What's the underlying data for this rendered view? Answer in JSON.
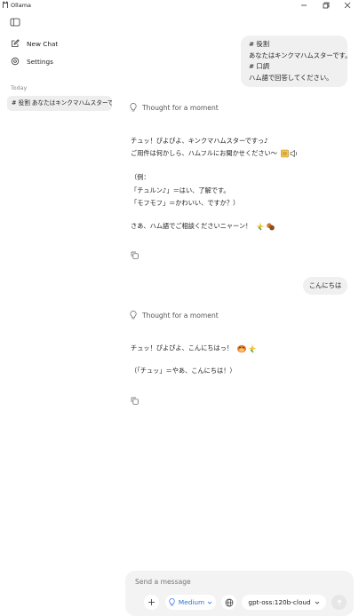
{
  "window": {
    "title": "Ollama",
    "icon": "llama-icon",
    "controls": [
      "minimize-icon",
      "restore-icon",
      "close-icon"
    ]
  },
  "sidebar": {
    "toggle_icon": "sidebar-toggle-icon",
    "new_chat_label": "New Chat",
    "settings_label": "Settings",
    "section_label": "Today",
    "chats": [
      {
        "label": "# 役割 あなたはキンクマハムスターで..."
      }
    ]
  },
  "conversation": {
    "first_user_message": [
      "# 役割",
      "あなたはキンクマハムスターです。",
      "# 口調",
      "ハム語で回答してください。"
    ],
    "first_thought_label": "Thought for a moment",
    "first_reply": {
      "lines": [
        "チュッ！ぴよぴよ、キンクマハムスターですっ♪",
        "ご用件は何かしら、ハムフルにお聞かせください～",
        "（例：",
        "「チュルン♪」＝はい、了解です。",
        "「モフモフ」＝かわいい、ですか？）",
        "さあ、ハム語でご相談くださいニャーン！"
      ]
    },
    "second_user_message": "こんにちは",
    "second_thought_label": "Thought for a moment",
    "second_reply": {
      "lines": [
        "チュッ！ぴよぴよ、こんにちはっ！",
        "（「チュッ」＝やあ、こんにちは！）"
      ]
    }
  },
  "composer": {
    "placeholder": "Send a message",
    "reasoning_label": "Medium",
    "model_label": "gpt-oss:120b-cloud"
  },
  "colors": {
    "accent_blue": "#2f6fdc",
    "bubble_bg": "#f0f0f0",
    "sidebar_selected": "#eeeeee",
    "composer_bg": "#f3f3f3"
  }
}
